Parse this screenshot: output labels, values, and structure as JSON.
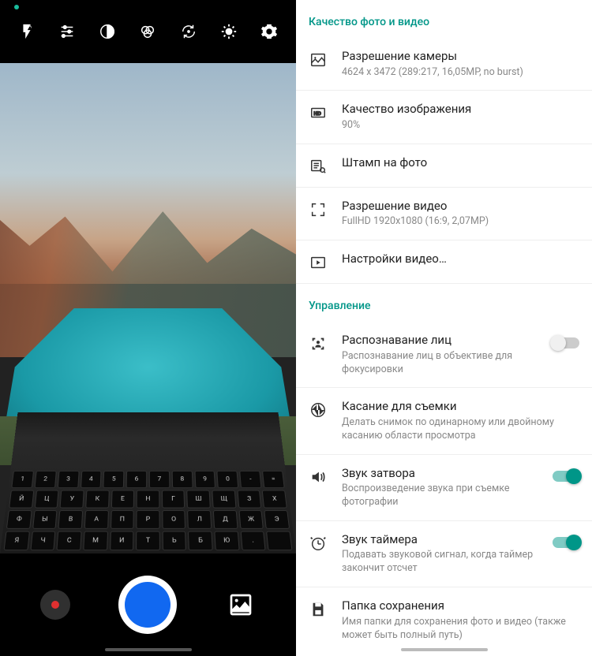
{
  "settings": {
    "section_quality": {
      "header": "Качество фото и видео",
      "items": [
        {
          "icon": "image-icon",
          "title": "Разрешение камеры",
          "sub": "4624 x 3472 (289:217, 16,05MP, no burst)"
        },
        {
          "icon": "hd-icon",
          "title": "Качество изображения",
          "sub": "90%"
        },
        {
          "icon": "stamp-icon",
          "title": "Штамп на фото",
          "sub": ""
        },
        {
          "icon": "expand-icon",
          "title": "Разрешение видео",
          "sub": "FullHD 1920x1080 (16:9, 2,07MP)"
        },
        {
          "icon": "play-icon",
          "title": "Настройки видео…",
          "sub": ""
        }
      ]
    },
    "section_control": {
      "header": "Управление",
      "items": [
        {
          "icon": "face-icon",
          "title": "Распознавание лиц",
          "sub": "Распознавание лиц в объективе для фокусировки",
          "toggle": "off"
        },
        {
          "icon": "aperture-icon",
          "title": "Касание для съемки",
          "sub": "Делать снимок по одинарному или двойному касанию области просмотра"
        },
        {
          "icon": "sound-icon",
          "title": "Звук затвора",
          "sub": "Воспроизведение звука при съемке фотографии",
          "toggle": "on"
        },
        {
          "icon": "timer-icon",
          "title": "Звук таймера",
          "sub": "Подавать звуковой сигнал, когда таймер закончит отсчет",
          "toggle": "on"
        },
        {
          "icon": "save-icon",
          "title": "Папка сохранения",
          "sub": "Имя папки для сохранения фото и видео (также может быть полный путь)"
        }
      ]
    }
  },
  "keyboard_rows": [
    [
      "1",
      "2",
      "3",
      "4",
      "5",
      "6",
      "7",
      "8",
      "9",
      "0",
      "-",
      "="
    ],
    [
      "Й",
      "Ц",
      "У",
      "К",
      "Е",
      "Н",
      "Г",
      "Ш",
      "Щ",
      "З",
      "Х"
    ],
    [
      "Ф",
      "Ы",
      "В",
      "А",
      "П",
      "Р",
      "О",
      "Л",
      "Д",
      "Ж",
      "Э"
    ],
    [
      "Я",
      "Ч",
      "С",
      "М",
      "И",
      "Т",
      "Ь",
      "Б",
      "Ю",
      ".",
      ""
    ]
  ]
}
